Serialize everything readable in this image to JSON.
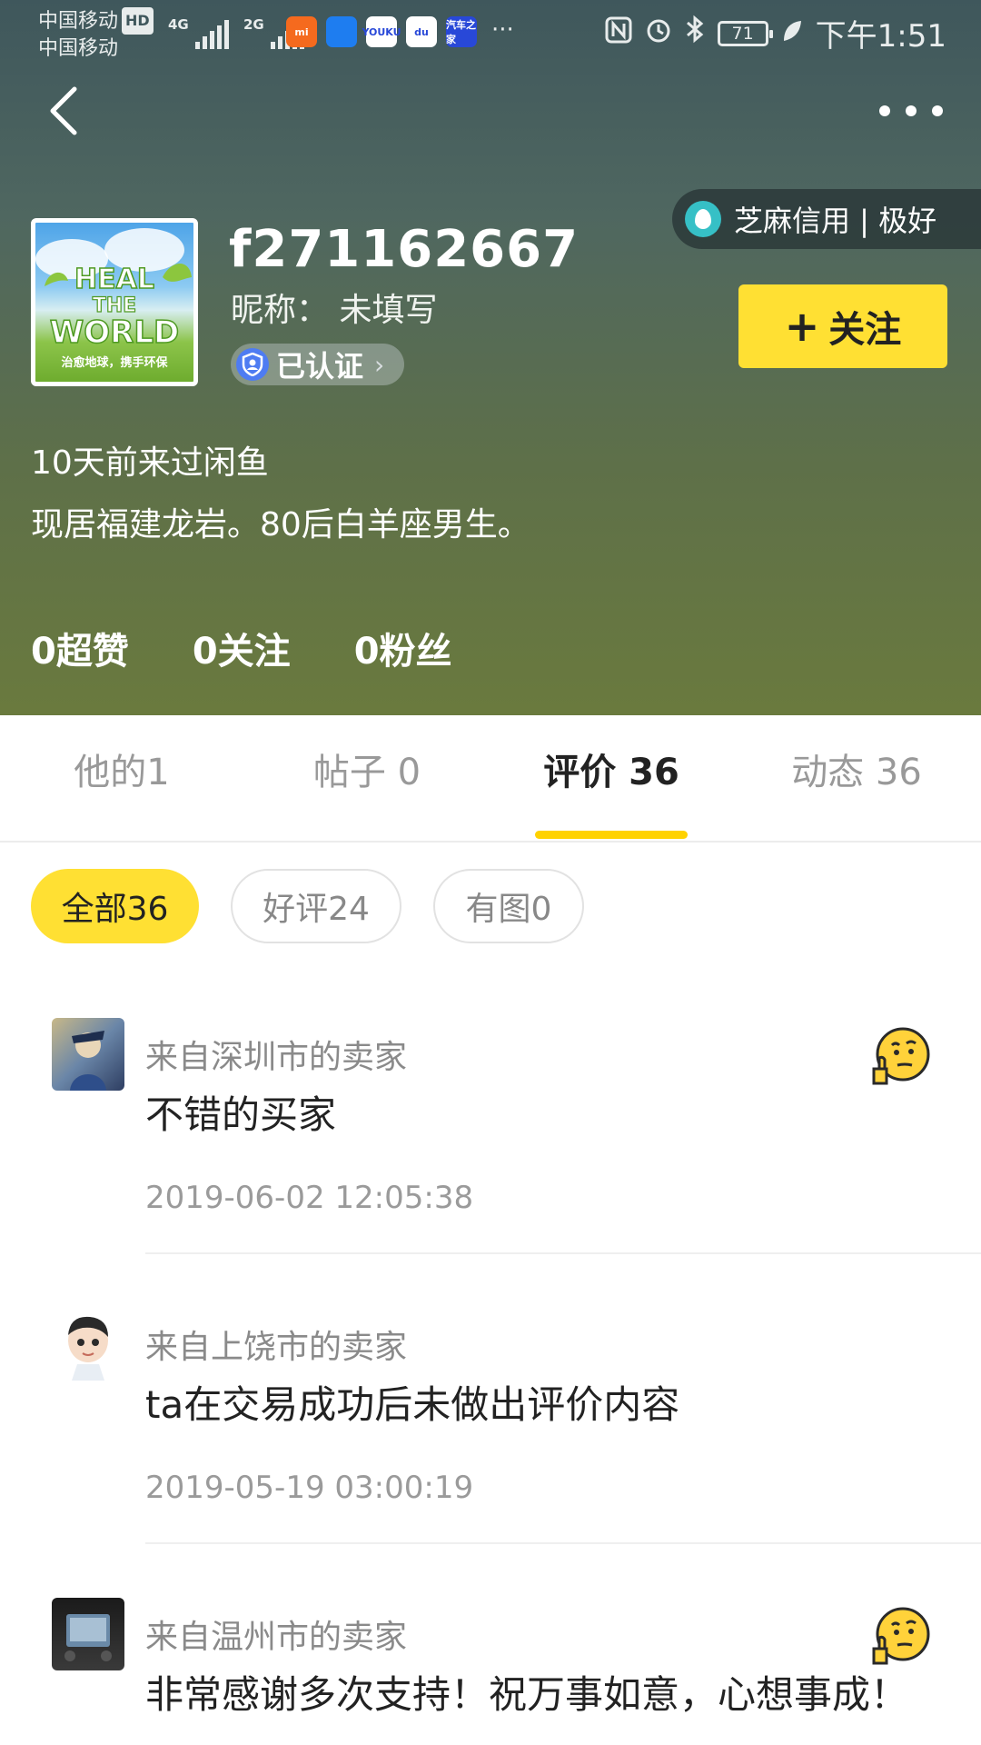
{
  "status_bar": {
    "carrier_1": "中国移动",
    "carrier_2": "中国移动",
    "hd": "HD",
    "net_1": "4G",
    "net_2": "2G",
    "battery": "71",
    "time": "下午1:51",
    "app_icons": [
      {
        "name": "mi-icon",
        "label": "mi",
        "color": "#f56a1e"
      },
      {
        "name": "shield-app-icon",
        "label": "",
        "color": "#1e7df0"
      },
      {
        "name": "youku-icon",
        "label": "YOUKU",
        "color": "#ffffff"
      },
      {
        "name": "baidu-icon",
        "label": "du",
        "color": "#ffffff"
      },
      {
        "name": "autohome-icon",
        "label": "汽车之家",
        "color": "#2848d8"
      }
    ]
  },
  "header": {
    "sesame_credit": "芝麻信用 | 极好",
    "avatar_text": "HEAL THE WORLD",
    "avatar_subtext": "治愈地球，携手环保",
    "username": "f271162667",
    "nickname": "昵称： 未填写",
    "verified": "已认证",
    "follow_label": "关注",
    "last_seen": "10天前来过闲鱼",
    "bio": "现居福建龙岩。80后白羊座男生。",
    "stats": {
      "likes": "0超赞",
      "following": "0关注",
      "fans": "0粉丝"
    }
  },
  "tabs": [
    {
      "label": "他的1",
      "active": false
    },
    {
      "label": "帖子 0",
      "active": false
    },
    {
      "label": "评价 36",
      "active": true
    },
    {
      "label": "动态 36",
      "active": false
    }
  ],
  "filters": [
    {
      "label": "全部36",
      "active": true
    },
    {
      "label": "好评24",
      "active": false
    },
    {
      "label": "有图0",
      "active": false
    }
  ],
  "reviews": [
    {
      "from": "来自深圳市的卖家",
      "text": "不错的买家",
      "time": "2019-06-02 12:05:38",
      "has_emoji": true
    },
    {
      "from": "来自上饶市的卖家",
      "text": "ta在交易成功后未做出评价内容",
      "time": "2019-05-19 03:00:19",
      "has_emoji": false
    },
    {
      "from": "来自温州市的卖家",
      "text": "非常感谢多次支持！祝万事如意，心想事成！",
      "time": "",
      "has_emoji": true
    }
  ],
  "colors": {
    "accent_yellow": "#ffe033",
    "tab_underline": "#ffd200",
    "header_top": "#3f575c",
    "header_bottom": "#6a7a3e"
  }
}
